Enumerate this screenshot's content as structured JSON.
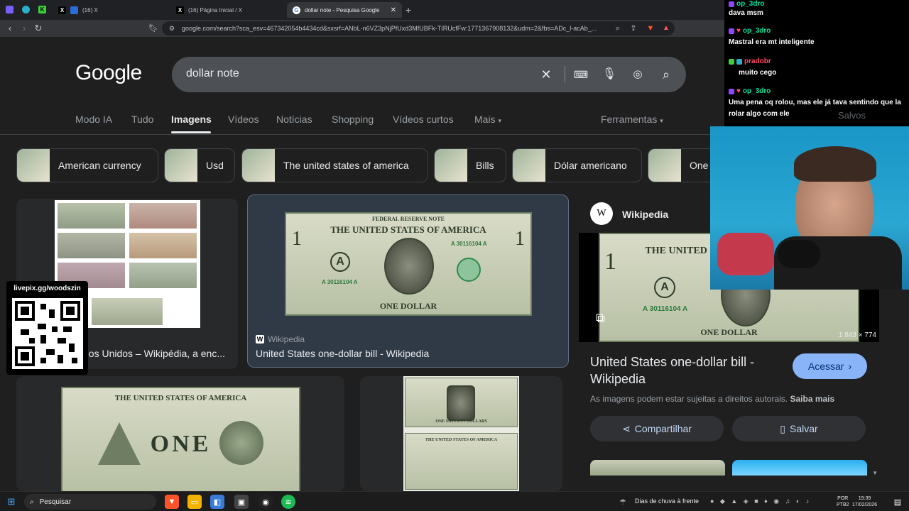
{
  "browser": {
    "tabs": [
      {
        "label": "(16) X"
      },
      {
        "label": "(16) Página Inicial / X"
      },
      {
        "label": "dollar note - Pesquisa Google"
      }
    ],
    "url": "google.com/search?sca_esv=467342054b4434cd&sxsrf=ANbL-n6VZ3pNjPfUxd3MfUBFk-TIRUcfFw:1771367908132&udm=2&fbs=ADc_l-acAb_..."
  },
  "google": {
    "logo": "Google",
    "query": "dollar note",
    "nav_tabs": [
      {
        "label": "Modo IA"
      },
      {
        "label": "Tudo"
      },
      {
        "label": "Imagens"
      },
      {
        "label": "Vídeos"
      },
      {
        "label": "Notícias"
      },
      {
        "label": "Shopping"
      },
      {
        "label": "Vídeos curtos"
      },
      {
        "label": "Mais"
      }
    ],
    "tools_label": "Ferramentas",
    "chips": [
      {
        "label": "American currency"
      },
      {
        "label": "Usd"
      },
      {
        "label": "The united states of america"
      },
      {
        "label": "Bills"
      },
      {
        "label": "Dólar americano"
      },
      {
        "label": "One"
      }
    ],
    "results": [
      {
        "caption": "dos Unidos – Wikipédia, a enc..."
      },
      {
        "source": "Wikipedia",
        "caption": "United States one-dollar bill - Wikipedia"
      }
    ],
    "bill_text": {
      "federal": "FEDERAL RESERVE NOTE",
      "usa": "THE UNITED STATES OF AMERICA",
      "one_dollar": "ONE DOLLAR",
      "serial": "A 30116104 A",
      "one": "ONE",
      "million": "ONE MILLION DOLLARS"
    }
  },
  "panel": {
    "source": "Wikipedia",
    "dimensions": "1 843 × 774",
    "title": "United States one-dollar bill - Wikipedia",
    "visit_label": "Acessar",
    "copyright": "As imagens podem estar sujeitas a direitos autorais.",
    "learn_more": "Saiba mais",
    "share_label": "Compartilhar",
    "save_label": "Salvar",
    "saved_label": "Salvos"
  },
  "chat": {
    "messages": [
      {
        "user": "op_3dro",
        "text": "dava msm"
      },
      {
        "user": "op_3dro",
        "text": "Mastral era mt inteligente"
      },
      {
        "user": "pradobr",
        "text": "muito cego"
      },
      {
        "user": "op_3dro",
        "text": "Uma pena oq rolou, mas ele já tava sentindo que la rolar algo com ele"
      }
    ],
    "colors": {
      "op_3dro": "#00e0a0",
      "pradobr": "#4ad94a"
    }
  },
  "qr": {
    "label": "livepix.gg/woodszin"
  },
  "taskbar": {
    "search_label": "Pesquisar",
    "weather": "Dias de chuva à frente",
    "lang": "POR",
    "lang2": "PTB2",
    "time": "19:39",
    "date": "17/02/2026"
  }
}
